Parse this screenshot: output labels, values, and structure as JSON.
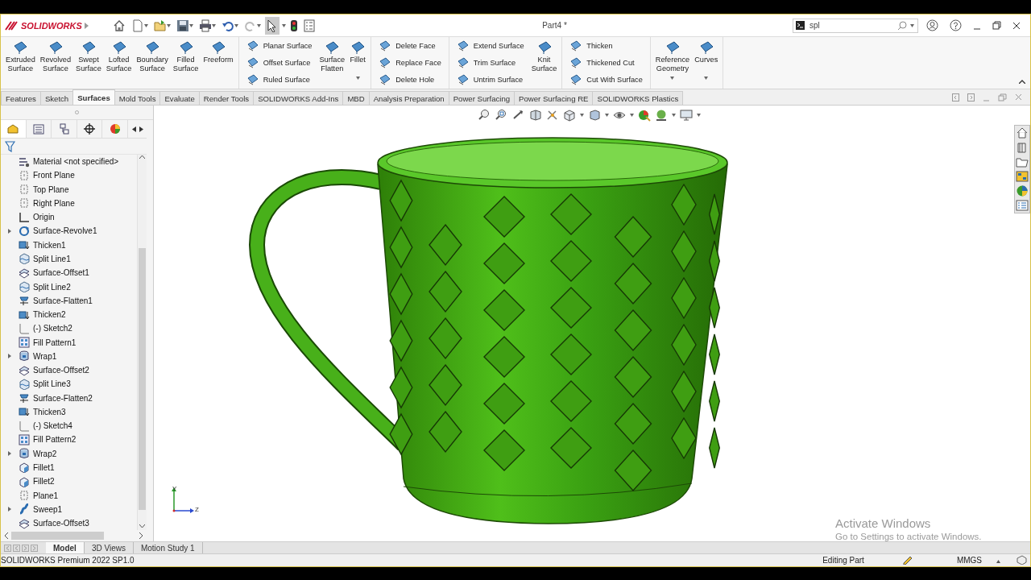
{
  "app": {
    "logo": "SOLIDWORKS",
    "title": "Part4 *",
    "search": {
      "value": "spl"
    },
    "quick_access": {
      "select_active": true
    }
  },
  "ribbon": {
    "groups": [
      [
        {
          "kind": "large",
          "items": [
            {
              "label": "Extruded Surface",
              "dropdown": false
            },
            {
              "label": "Revolved Surface",
              "dropdown": false
            },
            {
              "label": "Swept Surface",
              "dropdown": false
            },
            {
              "label": "Lofted Surface",
              "dropdown": false
            },
            {
              "label": "Boundary Surface",
              "dropdown": false
            },
            {
              "label": "Filled Surface",
              "dropdown": false
            },
            {
              "label": "Freeform",
              "dropdown": false
            }
          ]
        }
      ],
      [
        {
          "kind": "stack",
          "items": [
            {
              "label": "Planar Surface"
            },
            {
              "label": "Offset Surface"
            },
            {
              "label": "Ruled Surface"
            }
          ]
        },
        {
          "kind": "large",
          "items": [
            {
              "label": "Surface Flatten",
              "dropdown": false
            },
            {
              "label": "Fillet",
              "dropdown": true
            }
          ]
        }
      ],
      [
        {
          "kind": "stack",
          "items": [
            {
              "label": "Delete Face"
            },
            {
              "label": "Replace Face"
            },
            {
              "label": "Delete Hole"
            }
          ]
        }
      ],
      [
        {
          "kind": "stack",
          "items": [
            {
              "label": "Extend Surface"
            },
            {
              "label": "Trim Surface"
            },
            {
              "label": "Untrim Surface"
            }
          ]
        },
        {
          "kind": "large",
          "items": [
            {
              "label": "Knit Surface",
              "dropdown": false
            }
          ]
        }
      ],
      [
        {
          "kind": "stack",
          "items": [
            {
              "label": "Thicken"
            },
            {
              "label": "Thickened Cut"
            },
            {
              "label": "Cut With Surface"
            }
          ]
        }
      ],
      [
        {
          "kind": "large",
          "items": [
            {
              "label": "Reference Geometry",
              "dropdown": true
            },
            {
              "label": "Curves",
              "dropdown": true
            }
          ]
        }
      ]
    ]
  },
  "tabs": [
    {
      "label": "Features",
      "selected": false
    },
    {
      "label": "Sketch",
      "selected": false
    },
    {
      "label": "Surfaces",
      "selected": true
    },
    {
      "label": "Mold Tools",
      "selected": false
    },
    {
      "label": "Evaluate",
      "selected": false
    },
    {
      "label": "Render Tools",
      "selected": false
    },
    {
      "label": "SOLIDWORKS Add-Ins",
      "selected": false
    },
    {
      "label": "MBD",
      "selected": false
    },
    {
      "label": "Analysis Preparation",
      "selected": false
    },
    {
      "label": "Power Surfacing",
      "selected": false
    },
    {
      "label": "Power Surfacing RE",
      "selected": false
    },
    {
      "label": "SOLIDWORKS Plastics",
      "selected": false
    }
  ],
  "tree": {
    "items": [
      {
        "name": "Material <not specified>",
        "kind": "material",
        "expandable": false
      },
      {
        "name": "Front Plane",
        "kind": "plane",
        "expandable": false
      },
      {
        "name": "Top Plane",
        "kind": "plane",
        "expandable": false
      },
      {
        "name": "Right Plane",
        "kind": "plane",
        "expandable": false
      },
      {
        "name": "Origin",
        "kind": "origin",
        "expandable": false
      },
      {
        "name": "Surface-Revolve1",
        "kind": "revolve",
        "expandable": true
      },
      {
        "name": "Thicken1",
        "kind": "thicken",
        "expandable": false
      },
      {
        "name": "Split Line1",
        "kind": "split",
        "expandable": false
      },
      {
        "name": "Surface-Offset1",
        "kind": "offset",
        "expandable": false
      },
      {
        "name": "Split Line2",
        "kind": "split",
        "expandable": false
      },
      {
        "name": "Surface-Flatten1",
        "kind": "flatten",
        "expandable": false
      },
      {
        "name": "Thicken2",
        "kind": "thicken",
        "expandable": false
      },
      {
        "name": "(-) Sketch2",
        "kind": "sketch",
        "expandable": false
      },
      {
        "name": "Fill Pattern1",
        "kind": "pattern",
        "expandable": false
      },
      {
        "name": "Wrap1",
        "kind": "wrap",
        "expandable": true
      },
      {
        "name": "Surface-Offset2",
        "kind": "offset",
        "expandable": false
      },
      {
        "name": "Split Line3",
        "kind": "split",
        "expandable": false
      },
      {
        "name": "Surface-Flatten2",
        "kind": "flatten",
        "expandable": false
      },
      {
        "name": "Thicken3",
        "kind": "thicken",
        "expandable": false
      },
      {
        "name": "(-) Sketch4",
        "kind": "sketch",
        "expandable": false
      },
      {
        "name": "Fill Pattern2",
        "kind": "pattern",
        "expandable": false
      },
      {
        "name": "Wrap2",
        "kind": "wrap",
        "expandable": true
      },
      {
        "name": "Fillet1",
        "kind": "fillet",
        "expandable": false
      },
      {
        "name": "Fillet2",
        "kind": "fillet",
        "expandable": false
      },
      {
        "name": "Plane1",
        "kind": "plane",
        "expandable": false
      },
      {
        "name": "Sweep1",
        "kind": "sweep",
        "expandable": true
      },
      {
        "name": "Surface-Offset3",
        "kind": "offset",
        "expandable": false
      }
    ]
  },
  "viewport": {
    "triad": {
      "y": "Y",
      "z": "Z"
    },
    "watermark": {
      "title": "Activate Windows",
      "text": "Go to Settings to activate Windows."
    }
  },
  "bottom_tabs": [
    {
      "label": "Model",
      "selected": true
    },
    {
      "label": "3D Views",
      "selected": false
    },
    {
      "label": "Motion Study 1",
      "selected": false
    }
  ],
  "status_bar": {
    "product": "SOLIDWORKS Premium 2022 SP1.0",
    "mode": "Editing Part",
    "units": "MMGS"
  }
}
